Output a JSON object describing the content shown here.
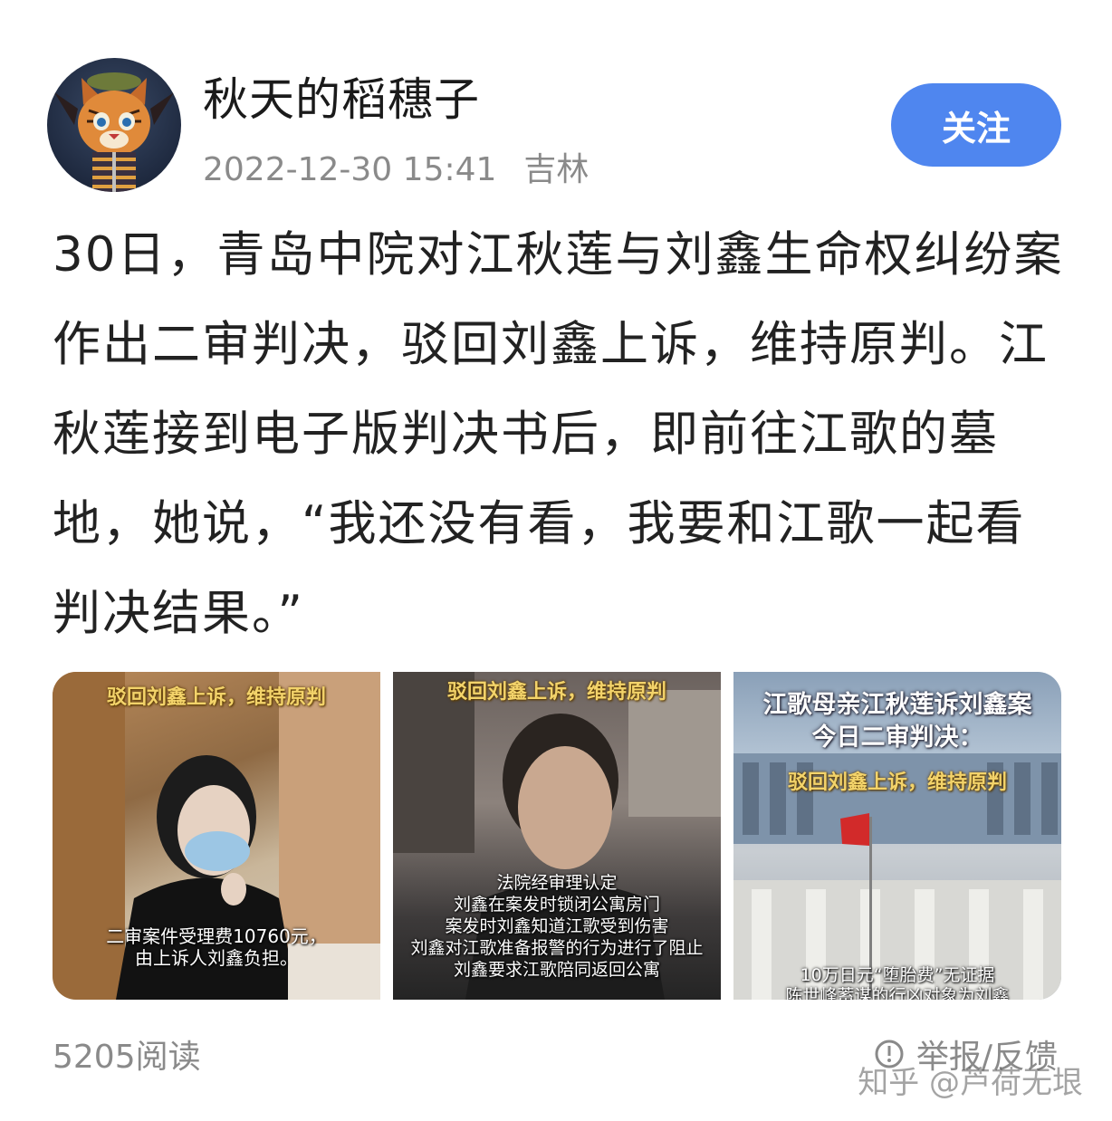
{
  "post": {
    "author": "秋天的稻穗子",
    "avatar_badge": "寅虎",
    "timestamp": "2022-12-30 15:41",
    "location": "吉林",
    "follow_label": "关注",
    "text": "30日，青岛中院对江秋莲与刘鑫生命权纠纷案作出二审判决，驳回刘鑫上诉，维持原判。江秋莲接到电子版判决书后，即前往江歌的墓地，她说，“我还没有看，我要和江歌一起看判决结果。”"
  },
  "images": [
    {
      "caption": "驳回刘鑫上诉，维持原判",
      "subtitle_lines": [
        "二审案件受理费10760元，",
        "由上诉人刘鑫负担。"
      ]
    },
    {
      "caption": "驳回刘鑫上诉，维持原判",
      "subtitle_lines": [
        "法院经审理认定",
        "刘鑫在案发时锁闭公寓房门",
        "案发时刘鑫知道江歌受到伤害",
        "刘鑫对江歌准备报警的行为进行了阻止",
        "刘鑫要求江歌陪同返回公寓"
      ]
    },
    {
      "title_lines": [
        "江歌母亲江秋莲诉刘鑫案",
        "今日二审判决："
      ],
      "caption": "驳回刘鑫上诉，维持原判",
      "subtitle_lines": [
        "10万日元“堕胎费”无证据",
        "陈世峰蓄谋的行凶对象为刘鑫"
      ]
    }
  ],
  "footer": {
    "reads": "5205阅读",
    "report_label": "举报/反馈",
    "report_icon": "report-icon"
  },
  "watermark": "知乎 @芦荷无垠",
  "colors": {
    "follow_button": "#4f86ef",
    "meta_text": "#8a8a8a",
    "caption_yellow": "#f3d36a"
  }
}
